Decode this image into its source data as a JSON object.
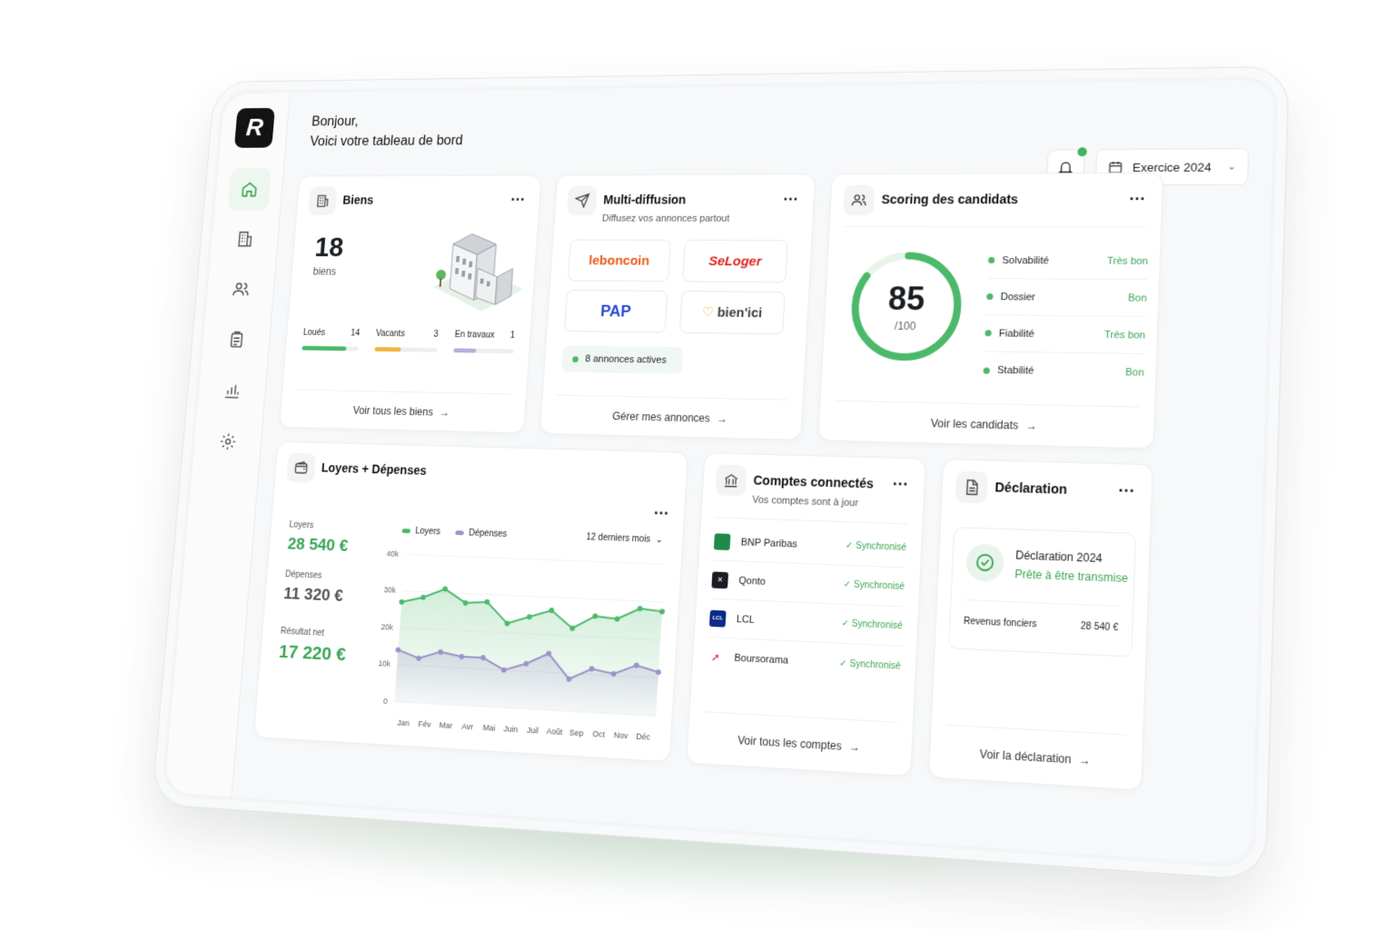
{
  "header": {
    "greeting": "Bonjour,",
    "subtitle": "Voici votre tableau de bord",
    "exercise": "Exercice 2024"
  },
  "biens": {
    "title": "Biens",
    "count": "18",
    "count_label": "biens",
    "stats": [
      {
        "label": "Loués",
        "value": "14",
        "ratio": 0.78,
        "color": "#4cb96a"
      },
      {
        "label": "Vacants",
        "value": "3",
        "ratio": 0.42,
        "color": "#f2b53a"
      },
      {
        "label": "En travaux",
        "value": "1",
        "ratio": 0.38,
        "color": "#b7aee0"
      }
    ],
    "link": "Voir tous les biens"
  },
  "multi": {
    "title": "Multi-diffusion",
    "subtitle": "Diffusez vos annonces partout",
    "portals": [
      "leboncoin",
      "SeLoger",
      "PAP",
      "bien'ici"
    ],
    "active": "8 annonces actives",
    "link": "Gérer mes annonces"
  },
  "scoring": {
    "title": "Scoring des candidats",
    "score": "85",
    "score_max": "/100",
    "score_value": 85,
    "criteria": [
      {
        "label": "Solvabilité",
        "value": "Très bon"
      },
      {
        "label": "Dossier",
        "value": "Bon"
      },
      {
        "label": "Fiabilité",
        "value": "Très bon"
      },
      {
        "label": "Stabilité",
        "value": "Bon"
      }
    ],
    "link": "Voir les candidats"
  },
  "finance": {
    "title": "Loyers + Dépenses",
    "loyers_label": "Loyers",
    "loyers_value": "28 540 €",
    "depenses_label": "Dépenses",
    "depenses_value": "11 320 €",
    "net_label": "Résultat net",
    "net_value": "17 220 €",
    "period": "12 derniers mois"
  },
  "chart_data": {
    "type": "area",
    "categories": [
      "Jan",
      "Fév",
      "Mar",
      "Avr",
      "Mai",
      "Juin",
      "Juil",
      "Août",
      "Sep",
      "Oct",
      "Nov",
      "Déc"
    ],
    "series": [
      {
        "name": "Loyers",
        "color": "#4cb96a",
        "values": [
          27000,
          28500,
          31000,
          27500,
          28000,
          22500,
          24500,
          26500,
          22000,
          25500,
          25000,
          28000,
          27500
        ]
      },
      {
        "name": "Dépenses",
        "color": "#9c93c7",
        "values": [
          14000,
          12000,
          14000,
          13000,
          13000,
          10000,
          12000,
          15000,
          8500,
          11500,
          10500,
          13000,
          11500
        ]
      }
    ],
    "yticks": [
      "0",
      "10k",
      "20k",
      "30k",
      "40k"
    ],
    "ylim": [
      0,
      40000
    ],
    "legend": "top"
  },
  "comptes": {
    "title": "Comptes connectés",
    "subtitle": "Vos comptes sont à jour",
    "accounts": [
      {
        "name": "BNP Paribas",
        "status": "Synchronisé",
        "color": "#1f8a4c",
        "mark": ""
      },
      {
        "name": "Qonto",
        "status": "Synchronisé",
        "color": "#1b1d22",
        "mark": "✕"
      },
      {
        "name": "LCL",
        "status": "Synchronisé",
        "color": "#0b2a8a",
        "mark": "LCL"
      },
      {
        "name": "Boursorama",
        "status": "Synchronisé",
        "color": "#e0157a",
        "mark": "➚"
      }
    ],
    "link": "Voir tous les comptes"
  },
  "declaration": {
    "title": "Déclaration",
    "doc_title": "Déclaration 2024",
    "doc_status": "Prête à être transmise",
    "revenus_label": "Revenus fonciers",
    "revenus_value": "28 540 €",
    "link": "Voir la déclaration"
  }
}
